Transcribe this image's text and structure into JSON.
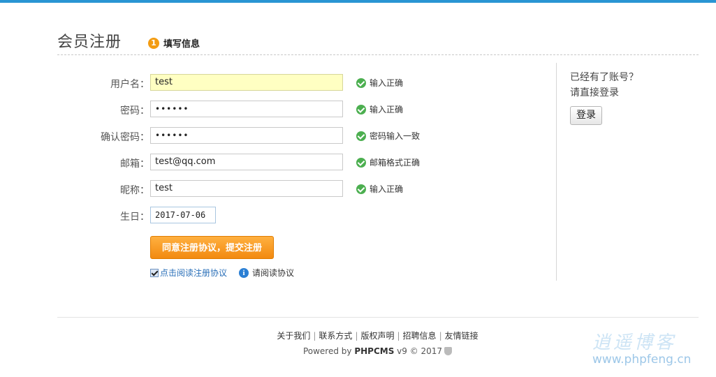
{
  "header": {
    "title": "会员注册",
    "step_number": "1",
    "step_label": "填写信息"
  },
  "form": {
    "fields": [
      {
        "label": "用户名：",
        "value": "test",
        "status": "输入正确"
      },
      {
        "label": "密码：",
        "value": "••••••",
        "status": "输入正确"
      },
      {
        "label": "确认密码：",
        "value": "••••••",
        "status": "密码输入一致"
      },
      {
        "label": "邮箱：",
        "value": "test@qq.com",
        "status": "邮箱格式正确"
      },
      {
        "label": "昵称：",
        "value": "test",
        "status": "输入正确"
      },
      {
        "label": "生日：",
        "value": "2017-07-06"
      }
    ],
    "submit_label": "同意注册协议，提交注册",
    "agree_label": "点击阅读注册协议",
    "agree_checked": true,
    "read_label": "请阅读协议"
  },
  "sidebar": {
    "line1": "已经有了账号？",
    "line2": "请直接登录",
    "login_label": "登录"
  },
  "footer": {
    "links": [
      "关于我们",
      "联系方式",
      "版权声明",
      "招聘信息",
      "友情链接"
    ],
    "separator": "|",
    "powered_prefix": "Powered by ",
    "powered_brand": "PHPCMS",
    "powered_suffix": " v9 © 2017"
  },
  "watermark": {
    "text": "逍遥博客",
    "url": "www.phpfeng.cn"
  },
  "colors": {
    "accent": "#2a95d3",
    "submit": "#f28a10",
    "success": "#4caf50",
    "focus_bg": "#ffffc2"
  }
}
